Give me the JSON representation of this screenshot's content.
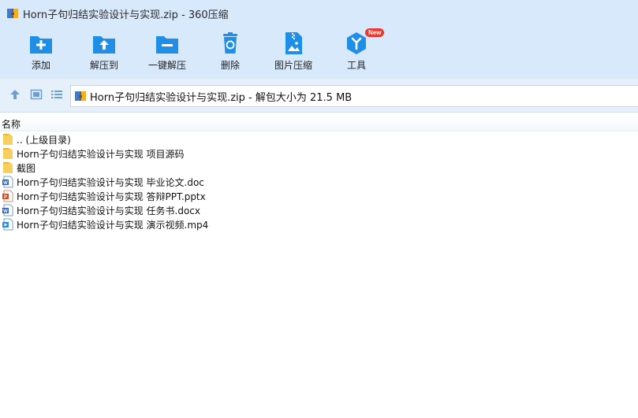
{
  "window": {
    "title": "Horn子句归结实验设计与实现.zip - 360压缩"
  },
  "toolbar": {
    "items": [
      {
        "label": "添加",
        "icon": "add-icon"
      },
      {
        "label": "解压到",
        "icon": "extract-to-icon"
      },
      {
        "label": "一键解压",
        "icon": "one-click-extract-icon"
      },
      {
        "label": "删除",
        "icon": "trash-icon"
      },
      {
        "label": "图片压缩",
        "icon": "image-compress-icon"
      },
      {
        "label": "工具",
        "icon": "tools-icon",
        "badge": "New"
      }
    ]
  },
  "nav": {
    "address": "Horn子句归结实验设计与实现.zip - 解包大小为 21.5 MB"
  },
  "list": {
    "column_name": "名称",
    "rows": [
      {
        "name": ".. (上级目录)",
        "icon": "folder-icon"
      },
      {
        "name": "Horn子句归结实验设计与实现 项目源码",
        "icon": "folder-icon"
      },
      {
        "name": "截图",
        "icon": "folder-icon"
      },
      {
        "name": "Horn子句归结实验设计与实现 毕业论文.doc",
        "icon": "word-doc-icon"
      },
      {
        "name": "Horn子句归结实验设计与实现 答辩PPT.pptx",
        "icon": "ppt-icon"
      },
      {
        "name": "Horn子句归结实验设计与实现 任务书.docx",
        "icon": "word-docx-icon"
      },
      {
        "name": "Horn子句归结实验设计与实现 演示视频.mp4",
        "icon": "video-icon"
      }
    ]
  },
  "colors": {
    "accent": "#1f8ee6",
    "titlebar": "#d8e9fb",
    "badge": "#e8372d"
  }
}
